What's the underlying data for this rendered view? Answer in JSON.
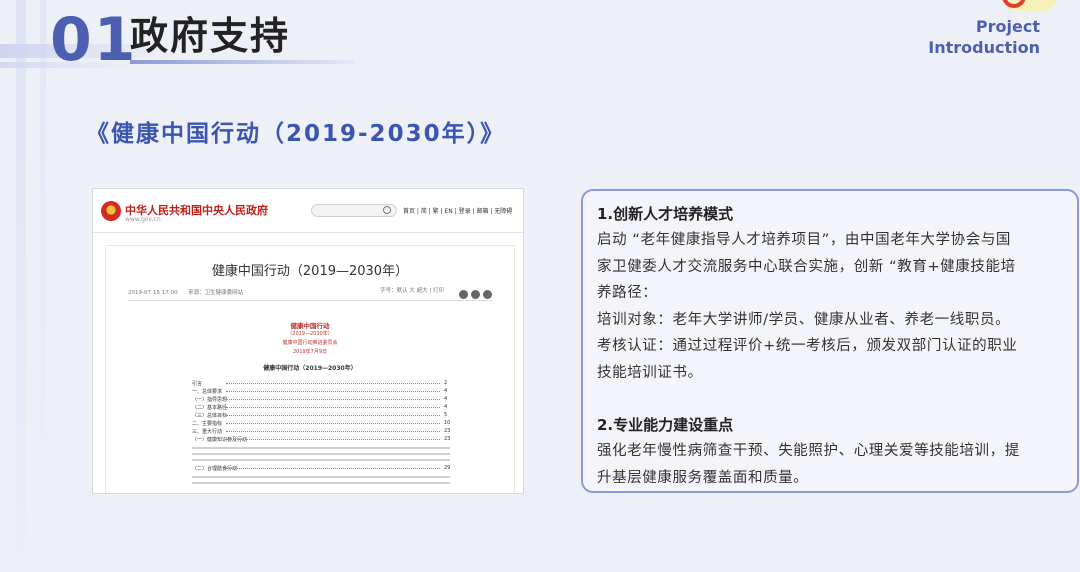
{
  "header": {
    "section_number": "01",
    "section_title": "政府支持",
    "project_line1": "Project",
    "project_line2": "Introduction"
  },
  "subtitle": "《健康中国行动（2019-2030年）》",
  "screenshot": {
    "site_name": "中华人民共和国中央人民政府",
    "site_url": "www.gov.cn",
    "nav": "首页 | 简 | 繁 | EN | 登录 | 邮箱 | 无障碍",
    "article_title": "健康中国行动（2019—2030年）",
    "meta_date": "2019-07-15 17:00",
    "meta_source": "来源：卫生健康委网站",
    "meta_right": "字号：默认 大 超大   |   打印",
    "doc_head1": "健康中国行动",
    "doc_head2": "（2019—2030年）",
    "doc_head3": "健康中国行动推进委员会",
    "doc_head4": "2019年7月9日",
    "doc_head5": "健康中国行动（2019—2030年）",
    "toc": [
      {
        "label": "引言",
        "page": "2"
      },
      {
        "label": "一、总体要求",
        "page": "4"
      },
      {
        "label": "（一）指导思想",
        "page": "4"
      },
      {
        "label": "（二）基本路径",
        "page": "4"
      },
      {
        "label": "（三）总体目标",
        "page": "5"
      },
      {
        "label": "二、主要指标",
        "page": "10"
      },
      {
        "label": "三、重大行动",
        "page": "23"
      },
      {
        "label": "（一）健康知识普及行动",
        "page": "23"
      }
    ],
    "toc_last": {
      "label": "（二）合理膳食行动",
      "page": "29"
    }
  },
  "card": {
    "heading1": "1.创新人才培养模式",
    "lines1": [
      "启动 “老年健康指导人才培养项目”，由中国老年大学协会与国",
      "家卫健委人才交流服务中心联合实施，创新 “教育+健康技能培",
      "养路径：",
      "培训对象：老年大学讲师/学员、健康从业者、养老一线职员。",
      "考核认证：通过过程评价+统一考核后，颁发双部门认证的职业",
      "技能培训证书。"
    ],
    "heading2": "2.专业能力建设重点",
    "lines2": [
      "强化老年慢性病筛查干预、失能照护、心理关爱等技能培训，提",
      "升基层健康服务覆盖面和质量。"
    ]
  }
}
